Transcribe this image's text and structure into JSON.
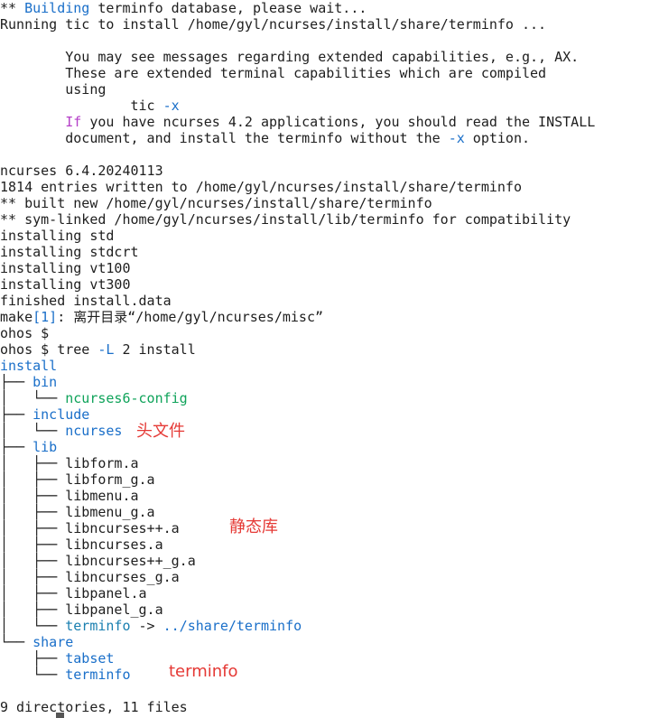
{
  "terminal": {
    "lines": [
      {
        "segs": [
          {
            "t": "** "
          },
          {
            "t": "Building",
            "c": "blue"
          },
          {
            "t": " terminfo database, please wait..."
          }
        ]
      },
      {
        "segs": [
          {
            "t": "Running tic to install /home/gyl/ncurses/install/share/terminfo ..."
          }
        ]
      },
      {
        "segs": [
          {
            "t": ""
          }
        ]
      },
      {
        "segs": [
          {
            "t": "        You may see messages regarding extended capabilities, e.g., AX."
          }
        ]
      },
      {
        "segs": [
          {
            "t": "        These are extended terminal capabilities which are compiled"
          }
        ]
      },
      {
        "segs": [
          {
            "t": "        using"
          }
        ]
      },
      {
        "segs": [
          {
            "t": "                tic "
          },
          {
            "t": "-x",
            "c": "blue"
          }
        ]
      },
      {
        "segs": [
          {
            "t": "        "
          },
          {
            "t": "If",
            "c": "magenta"
          },
          {
            "t": " you have ncurses 4.2 applications, you should read the INSTALL"
          }
        ]
      },
      {
        "segs": [
          {
            "t": "        document, and install the terminfo without the "
          },
          {
            "t": "-x",
            "c": "blue"
          },
          {
            "t": " option."
          }
        ]
      },
      {
        "segs": [
          {
            "t": ""
          }
        ]
      },
      {
        "segs": [
          {
            "t": "ncurses 6.4.20240113"
          }
        ]
      },
      {
        "segs": [
          {
            "t": "1814 entries written to /home/gyl/ncurses/install/share/terminfo"
          }
        ]
      },
      {
        "segs": [
          {
            "t": "** built new /home/gyl/ncurses/install/share/terminfo"
          }
        ]
      },
      {
        "segs": [
          {
            "t": "** sym-linked /home/gyl/ncurses/install/lib/terminfo for compatibility"
          }
        ]
      },
      {
        "segs": [
          {
            "t": "installing std"
          }
        ]
      },
      {
        "segs": [
          {
            "t": "installing stdcrt"
          }
        ]
      },
      {
        "segs": [
          {
            "t": "installing vt100"
          }
        ]
      },
      {
        "segs": [
          {
            "t": "installing vt300"
          }
        ]
      },
      {
        "segs": [
          {
            "t": "finished install.data"
          }
        ]
      },
      {
        "segs": [
          {
            "t": "make"
          },
          {
            "t": "[1]",
            "c": "blue"
          },
          {
            "t": ": 离开目录“/home/gyl/ncurses/misc”"
          }
        ]
      },
      {
        "segs": [
          {
            "t": "ohos $"
          }
        ]
      },
      {
        "segs": [
          {
            "t": "ohos $ tree "
          },
          {
            "t": "-L",
            "c": "blue"
          },
          {
            "t": " 2 install"
          }
        ]
      },
      {
        "segs": [
          {
            "t": "install",
            "c": "blue"
          }
        ]
      },
      {
        "segs": [
          {
            "t": "├── "
          },
          {
            "t": "bin",
            "c": "blue"
          }
        ]
      },
      {
        "segs": [
          {
            "t": "│   └── "
          },
          {
            "t": "ncurses6-config",
            "c": "green"
          }
        ]
      },
      {
        "segs": [
          {
            "t": "├── "
          },
          {
            "t": "include",
            "c": "blue"
          }
        ]
      },
      {
        "segs": [
          {
            "t": "│   └── "
          },
          {
            "t": "ncurses",
            "c": "blue"
          }
        ]
      },
      {
        "segs": [
          {
            "t": "├── "
          },
          {
            "t": "lib",
            "c": "blue"
          }
        ]
      },
      {
        "segs": [
          {
            "t": "│   ├── libform.a"
          }
        ]
      },
      {
        "segs": [
          {
            "t": "│   ├── libform_g.a"
          }
        ]
      },
      {
        "segs": [
          {
            "t": "│   ├── libmenu.a"
          }
        ]
      },
      {
        "segs": [
          {
            "t": "│   ├── libmenu_g.a"
          }
        ]
      },
      {
        "segs": [
          {
            "t": "│   ├── libncurses++.a"
          }
        ]
      },
      {
        "segs": [
          {
            "t": "│   ├── libncurses.a"
          }
        ]
      },
      {
        "segs": [
          {
            "t": "│   ├── libncurses++_g.a"
          }
        ]
      },
      {
        "segs": [
          {
            "t": "│   ├── libncurses_g.a"
          }
        ]
      },
      {
        "segs": [
          {
            "t": "│   ├── libpanel.a"
          }
        ]
      },
      {
        "segs": [
          {
            "t": "│   ├── libpanel_g.a"
          }
        ]
      },
      {
        "segs": [
          {
            "t": "│   └── "
          },
          {
            "t": "terminfo",
            "c": "teal"
          },
          {
            "t": " -> "
          },
          {
            "t": "../share/terminfo",
            "c": "blue"
          }
        ]
      },
      {
        "segs": [
          {
            "t": "└── "
          },
          {
            "t": "share",
            "c": "blue"
          }
        ]
      },
      {
        "segs": [
          {
            "t": "    ├── "
          },
          {
            "t": "tabset",
            "c": "blue"
          }
        ]
      },
      {
        "segs": [
          {
            "t": "    └── "
          },
          {
            "t": "terminfo",
            "c": "blue"
          }
        ]
      },
      {
        "segs": [
          {
            "t": ""
          }
        ]
      },
      {
        "segs": [
          {
            "t": "9 directories, 11 files"
          }
        ]
      }
    ]
  },
  "annotations": {
    "headers": "头文件",
    "static_libs": "静态库",
    "terminfo": "terminfo"
  },
  "colors": {
    "background": "#ffffff",
    "text": "#1e1e1e",
    "directory": "#1a6fc9",
    "executable": "#0fa35a",
    "keyword": "#b540c8",
    "annotation": "#e53935"
  }
}
